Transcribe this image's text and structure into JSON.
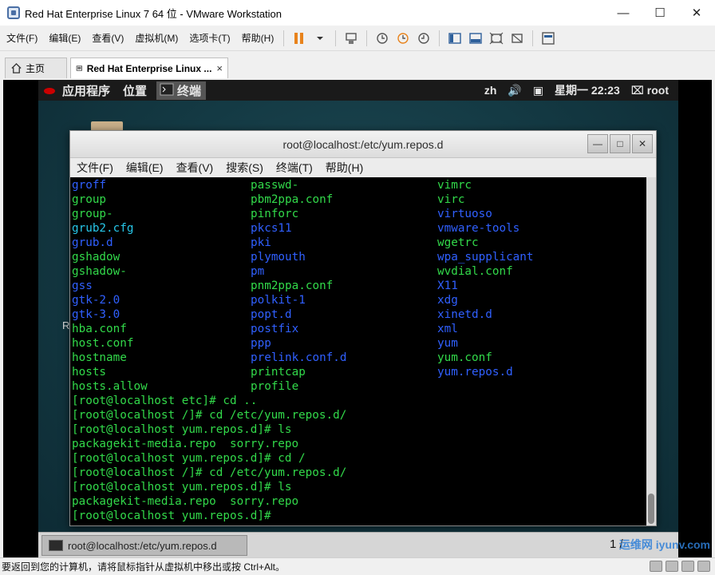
{
  "window": {
    "title": "Red Hat Enterprise Linux 7 64 位 - VMware Workstation",
    "controls": [
      "—",
      "☐",
      "✕"
    ]
  },
  "menu": [
    "文件(F)",
    "编辑(E)",
    "查看(V)",
    "虚拟机(M)",
    "选项卡(T)",
    "帮助(H)"
  ],
  "tabs": [
    {
      "label": "主页",
      "icon": "home-icon"
    },
    {
      "label": "Red Hat Enterprise Linux ...",
      "icon": "vm-icon",
      "close": "×"
    }
  ],
  "guest_topbar": {
    "apps": "应用程序",
    "places": "位置",
    "terminal": "终端",
    "lang": "zh",
    "clock": "星期一 22:23",
    "user": "root"
  },
  "desktop": {
    "partial_label": "R"
  },
  "terminal": {
    "title": "root@localhost:/etc/yum.repos.d",
    "menu": [
      "文件(F)",
      "编辑(E)",
      "查看(V)",
      "搜索(S)",
      "终端(T)",
      "帮助(H)"
    ],
    "ls_rows": [
      [
        {
          "t": "groff",
          "c": "blue"
        },
        {
          "t": "passwd-",
          "c": "green"
        },
        {
          "t": "vimrc",
          "c": "green"
        }
      ],
      [
        {
          "t": "group",
          "c": "green"
        },
        {
          "t": "pbm2ppa.conf",
          "c": "green"
        },
        {
          "t": "virc",
          "c": "green"
        }
      ],
      [
        {
          "t": "group-",
          "c": "green"
        },
        {
          "t": "pinforc",
          "c": "green"
        },
        {
          "t": "virtuoso",
          "c": "blue"
        }
      ],
      [
        {
          "t": "grub2.cfg",
          "c": "cyan"
        },
        {
          "t": "pkcs11",
          "c": "blue"
        },
        {
          "t": "vmware-tools",
          "c": "blue"
        }
      ],
      [
        {
          "t": "grub.d",
          "c": "blue"
        },
        {
          "t": "pki",
          "c": "blue"
        },
        {
          "t": "wgetrc",
          "c": "green"
        }
      ],
      [
        {
          "t": "gshadow",
          "c": "green"
        },
        {
          "t": "plymouth",
          "c": "blue"
        },
        {
          "t": "wpa_supplicant",
          "c": "blue"
        }
      ],
      [
        {
          "t": "gshadow-",
          "c": "green"
        },
        {
          "t": "pm",
          "c": "blue"
        },
        {
          "t": "wvdial.conf",
          "c": "green"
        }
      ],
      [
        {
          "t": "gss",
          "c": "blue"
        },
        {
          "t": "pnm2ppa.conf",
          "c": "green"
        },
        {
          "t": "X11",
          "c": "blue"
        }
      ],
      [
        {
          "t": "gtk-2.0",
          "c": "blue"
        },
        {
          "t": "polkit-1",
          "c": "blue"
        },
        {
          "t": "xdg",
          "c": "blue"
        }
      ],
      [
        {
          "t": "gtk-3.0",
          "c": "blue"
        },
        {
          "t": "popt.d",
          "c": "blue"
        },
        {
          "t": "xinetd.d",
          "c": "blue"
        }
      ],
      [
        {
          "t": "hba.conf",
          "c": "green"
        },
        {
          "t": "postfix",
          "c": "blue"
        },
        {
          "t": "xml",
          "c": "blue"
        }
      ],
      [
        {
          "t": "host.conf",
          "c": "green"
        },
        {
          "t": "ppp",
          "c": "blue"
        },
        {
          "t": "yum",
          "c": "blue"
        }
      ],
      [
        {
          "t": "hostname",
          "c": "green"
        },
        {
          "t": "prelink.conf.d",
          "c": "blue"
        },
        {
          "t": "yum.conf",
          "c": "green"
        }
      ],
      [
        {
          "t": "hosts",
          "c": "green"
        },
        {
          "t": "printcap",
          "c": "green"
        },
        {
          "t": "yum.repos.d",
          "c": "blue"
        }
      ],
      [
        {
          "t": "hosts.allow",
          "c": "green"
        },
        {
          "t": "profile",
          "c": "green"
        },
        {
          "t": "",
          "c": "green"
        }
      ]
    ],
    "lines": [
      "[root@localhost etc]# cd ..",
      "[root@localhost /]# cd /etc/yum.repos.d/",
      "[root@localhost yum.repos.d]# ls",
      "packagekit-media.repo  sorry.repo",
      "[root@localhost yum.repos.d]# cd /",
      "[root@localhost /]# cd /etc/yum.repos.d/",
      "[root@localhost yum.repos.d]# ls",
      "packagekit-media.repo  sorry.repo",
      "[root@localhost yum.repos.d]# "
    ]
  },
  "taskbar": {
    "item": "root@localhost:/etc/yum.repos.d",
    "page": "1 /"
  },
  "status": {
    "text": "要返回到您的计算机，请将鼠标指针从虚拟机中移出或按 Ctrl+Alt。",
    "watermark": "运维网 iyunv.com"
  }
}
